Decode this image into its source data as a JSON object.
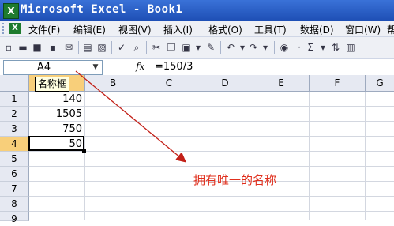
{
  "window": {
    "title": "Microsoft Excel - Book1"
  },
  "menu": [
    "文件(F)",
    "编辑(E)",
    "视图(V)",
    "插入(I)",
    "格式(O)",
    "工具(T)",
    "数据(D)",
    "窗口(W)",
    "帮"
  ],
  "formula_bar": {
    "name_box": "A4",
    "fx": "fx",
    "formula": "=150/3"
  },
  "columns": [
    "A",
    "B",
    "C",
    "D",
    "E",
    "F",
    "G"
  ],
  "rows": [
    "1",
    "2",
    "3",
    "4",
    "5",
    "6",
    "7",
    "8",
    "9"
  ],
  "cells": {
    "A1": "140",
    "A2": "1505",
    "A3": "750",
    "A4": "50"
  },
  "tooltip": "名称框",
  "annotation": "拥有唯一的名称",
  "colors": {
    "annotation": "#e0301e",
    "title_bar": "#1e4fb5"
  }
}
